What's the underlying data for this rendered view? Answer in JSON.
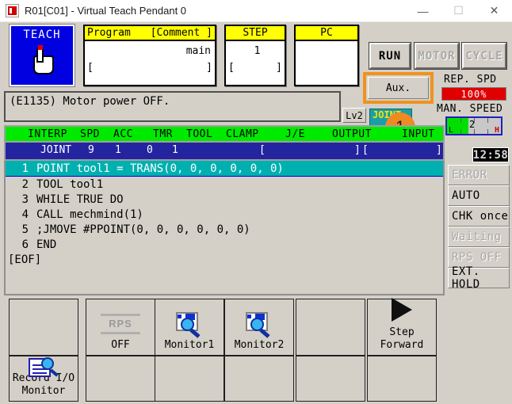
{
  "titlebar": {
    "title": "R01[C01] - Virtual Teach Pendant 0",
    "minimize": "—",
    "maximize": "☐",
    "close": "✕"
  },
  "teach_button": {
    "label": "TEACH"
  },
  "panels": {
    "program": {
      "header_left": "Program",
      "header_right": "[Comment ]",
      "value": "main",
      "bracket_left": "[",
      "bracket_right": "]"
    },
    "step": {
      "header": "STEP",
      "value": "1",
      "bracket_left": "[",
      "bracket_right": "]"
    },
    "pc": {
      "header": "PC",
      "value": "",
      "bracket_left": "",
      "bracket_right": ""
    }
  },
  "mode_buttons": {
    "run": "RUN",
    "motor": "MOTOR",
    "cycle": "CYCLE",
    "aux": "Aux."
  },
  "speeds": {
    "rep_spd_label": "REP. SPD",
    "rep_spd_value": "100%",
    "man_speed_label": "MAN. SPEED",
    "man_speed_value": "2",
    "man_speed_low": "L",
    "man_speed_high": "H"
  },
  "message": {
    "text": "(E1135) Motor power OFF.",
    "level": "Lv2",
    "joint_icon_label": "JOINT",
    "joint_badge": "1"
  },
  "table": {
    "headers": [
      "INTERP",
      "SPD",
      "ACC",
      "TMR",
      "TOOL",
      "CLAMP",
      "J/E",
      "OUTPUT",
      "INPUT"
    ],
    "row": {
      "interp": "JOINT",
      "spd": "9",
      "acc": "1",
      "tmr": "0",
      "tool": "1",
      "clamp": "",
      "je": "",
      "output_open": "[",
      "output_close": "]",
      "input_open": "[",
      "input_close": "]"
    }
  },
  "code": {
    "lines": [
      {
        "num": "1",
        "text": "POINT tool1 = TRANS(0, 0, 0, 0, 0, 0)",
        "selected": true
      },
      {
        "num": "2",
        "text": "TOOL tool1",
        "selected": false
      },
      {
        "num": "3",
        "text": "WHILE TRUE DO",
        "selected": false
      },
      {
        "num": "4",
        "text": "CALL mechmind(1)",
        "selected": false
      },
      {
        "num": "5",
        "text": ";JMOVE #PPOINT(0, 0, 0, 0, 0, 0)",
        "selected": false
      },
      {
        "num": "6",
        "text": "END",
        "selected": false
      }
    ],
    "eof": "[EOF]"
  },
  "status": {
    "clock": "12:58",
    "items": [
      {
        "label": "ERROR",
        "enabled": false
      },
      {
        "label": "AUTO",
        "enabled": true
      },
      {
        "label": "CHK once",
        "enabled": true
      },
      {
        "label": "Waiting",
        "enabled": false
      },
      {
        "label": "RPS OFF",
        "enabled": false
      },
      {
        "label": "EXT. HOLD",
        "enabled": true
      }
    ]
  },
  "bottom_buttons": {
    "top_row": [
      {
        "label": "",
        "icon": "none",
        "enabled": true
      },
      {
        "label": "OFF",
        "icon": "rps-icon",
        "enabled": false
      },
      {
        "label": "Monitor1",
        "icon": "monitor-icon",
        "enabled": true
      },
      {
        "label": "Monitor2",
        "icon": "monitor-icon",
        "enabled": true
      },
      {
        "label": "",
        "icon": "none",
        "enabled": true
      },
      {
        "label": "Step\nForward",
        "icon": "play-icon",
        "enabled": false
      }
    ],
    "bottom_row": [
      {
        "label": "Record I/O\nMonitor",
        "icon": "record-io-icon",
        "enabled": true
      },
      {
        "label": "",
        "icon": "none",
        "enabled": true
      },
      {
        "label": "",
        "icon": "none",
        "enabled": true
      },
      {
        "label": "",
        "icon": "none",
        "enabled": true
      },
      {
        "label": "",
        "icon": "none",
        "enabled": true
      },
      {
        "label": "",
        "icon": "none",
        "enabled": true
      }
    ],
    "rps_icon_text": "RPS",
    "step_forward_line1": "Step",
    "step_forward_line2": "Forward",
    "record_io_line1": "Record I/O",
    "record_io_line2": "Monitor"
  },
  "colors": {
    "accent_orange": "#ef8a21",
    "header_green": "#00ea00",
    "row_blue": "#2424a0",
    "selected_teal": "#00b0b0",
    "rep_spd_red": "#e00000",
    "man_speed_green": "#00e000",
    "teach_blue": "#0000e0",
    "field_yellow": "#ffff00"
  }
}
